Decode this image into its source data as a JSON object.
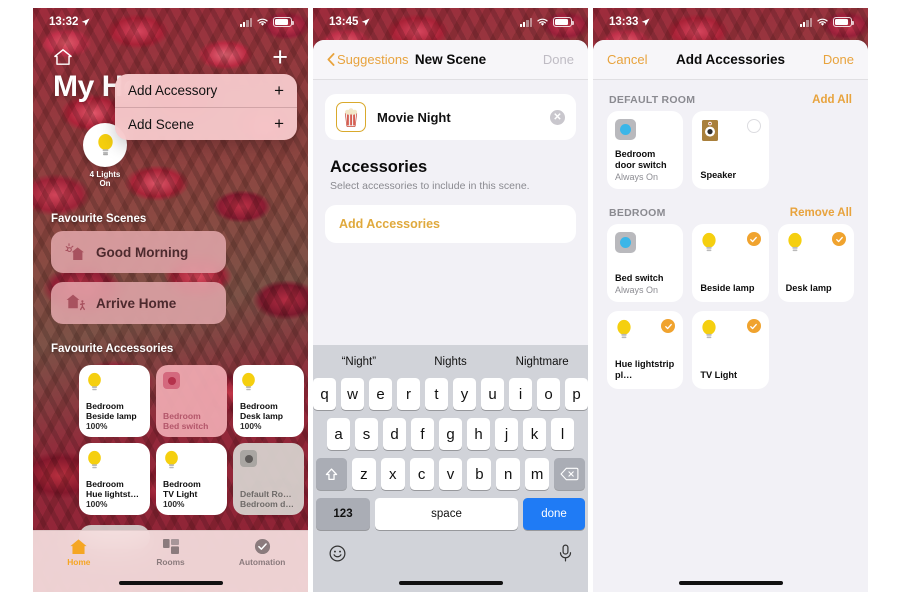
{
  "phone1": {
    "statusbar": {
      "time": "13:32",
      "location_icon": "location-arrow-icon",
      "wifi_icon": "wifi-icon",
      "cellular_icon": "cellular-bars-icon",
      "battery_icon": "battery-icon"
    },
    "topbar": {
      "home_icon": "home-icon",
      "add_label": "+"
    },
    "title": "My Ho",
    "popup": {
      "items": [
        {
          "label": "Add Accessory",
          "trailing": "+"
        },
        {
          "label": "Add Scene",
          "trailing": "+"
        }
      ]
    },
    "status_badge": {
      "icon": "lightbulb-icon",
      "line1": "4 Lights",
      "line2": "On"
    },
    "scenes_header": "Favourite Scenes",
    "scenes": [
      {
        "label": "Good Morning",
        "icon": "sunrise-house-icon"
      },
      {
        "label": "Arrive Home",
        "icon": "house-walking-icon"
      }
    ],
    "accessories_header": "Favourite Accessories",
    "accessories": [
      {
        "room": "Bedroom",
        "name": "Beside lamp",
        "state": "100%",
        "icon": "lightbulb-icon",
        "style": "on"
      },
      {
        "room": "Bedroom",
        "name": "Bed switch",
        "state": "",
        "icon": "switch-icon",
        "style": "sw"
      },
      {
        "room": "Bedroom",
        "name": "Desk lamp",
        "state": "100%",
        "icon": "lightbulb-icon",
        "style": "on"
      },
      {
        "room": "Bedroom",
        "name": "Hue lightst…",
        "state": "100%",
        "icon": "lightbulb-icon",
        "style": "on"
      },
      {
        "room": "Bedroom",
        "name": "TV Light",
        "state": "100%",
        "icon": "lightbulb-icon",
        "style": "on"
      },
      {
        "room": "Default Ro…",
        "name": "Bedroom d…",
        "state": "",
        "icon": "switch-icon",
        "style": "off"
      }
    ],
    "tabs": [
      {
        "label": "Home",
        "icon": "home-icon",
        "active": true
      },
      {
        "label": "Rooms",
        "icon": "rooms-icon",
        "active": false
      },
      {
        "label": "Automation",
        "icon": "automation-icon",
        "active": false
      }
    ]
  },
  "phone2": {
    "statusbar": {
      "time": "13:45"
    },
    "nav": {
      "back_label": "Suggestions",
      "back_icon": "chevron-left-icon",
      "title": "New Scene",
      "done_label": "Done"
    },
    "scene": {
      "name": "Movie Night",
      "icon": "popcorn-icon",
      "clear_icon": "clear-circle-icon"
    },
    "section": {
      "title": "Accessories",
      "subtitle": "Select accessories to include in this scene."
    },
    "add_accessories_label": "Add Accessories",
    "keyboard": {
      "suggestions": [
        "“Night”",
        "Nights",
        "Nightmare"
      ],
      "row1": [
        "q",
        "w",
        "e",
        "r",
        "t",
        "y",
        "u",
        "i",
        "o",
        "p"
      ],
      "row2": [
        "a",
        "s",
        "d",
        "f",
        "g",
        "h",
        "j",
        "k",
        "l"
      ],
      "row3": [
        "z",
        "x",
        "c",
        "v",
        "b",
        "n",
        "m"
      ],
      "shift_icon": "shift-icon",
      "backspace_icon": "backspace-icon",
      "numbers_label": "123",
      "space_label": "space",
      "done_label": "done",
      "emoji_icon": "emoji-icon",
      "mic_icon": "microphone-icon"
    }
  },
  "phone3": {
    "statusbar": {
      "time": "13:33"
    },
    "nav": {
      "cancel_label": "Cancel",
      "title": "Add Accessories",
      "done_label": "Done"
    },
    "groups": [
      {
        "name": "DEFAULT ROOM",
        "action": "Add All",
        "tiles": [
          {
            "name": "Bedroom door switch",
            "state": "Always On",
            "icon": "switch-icon",
            "selected": null
          },
          {
            "name": "Speaker",
            "state": "",
            "icon": "speaker-icon",
            "selected": false
          }
        ]
      },
      {
        "name": "BEDROOM",
        "action": "Remove All",
        "tiles": [
          {
            "name": "Bed switch",
            "state": "Always On",
            "icon": "switch-icon",
            "selected": null
          },
          {
            "name": "Beside lamp",
            "state": "",
            "icon": "lightbulb-icon",
            "selected": true
          },
          {
            "name": "Desk lamp",
            "state": "",
            "icon": "lightbulb-icon",
            "selected": true
          },
          {
            "name": "Hue lightstrip pl…",
            "state": "",
            "icon": "lightbulb-icon",
            "selected": true
          },
          {
            "name": "TV Light",
            "state": "",
            "icon": "lightbulb-icon",
            "selected": true
          }
        ]
      }
    ]
  },
  "colors": {
    "accent_orange": "#e8a33d",
    "bulb_yellow": "#f5cf0f",
    "blue_key": "#1f7bf5",
    "switch_blue": "#3bb6e8"
  }
}
